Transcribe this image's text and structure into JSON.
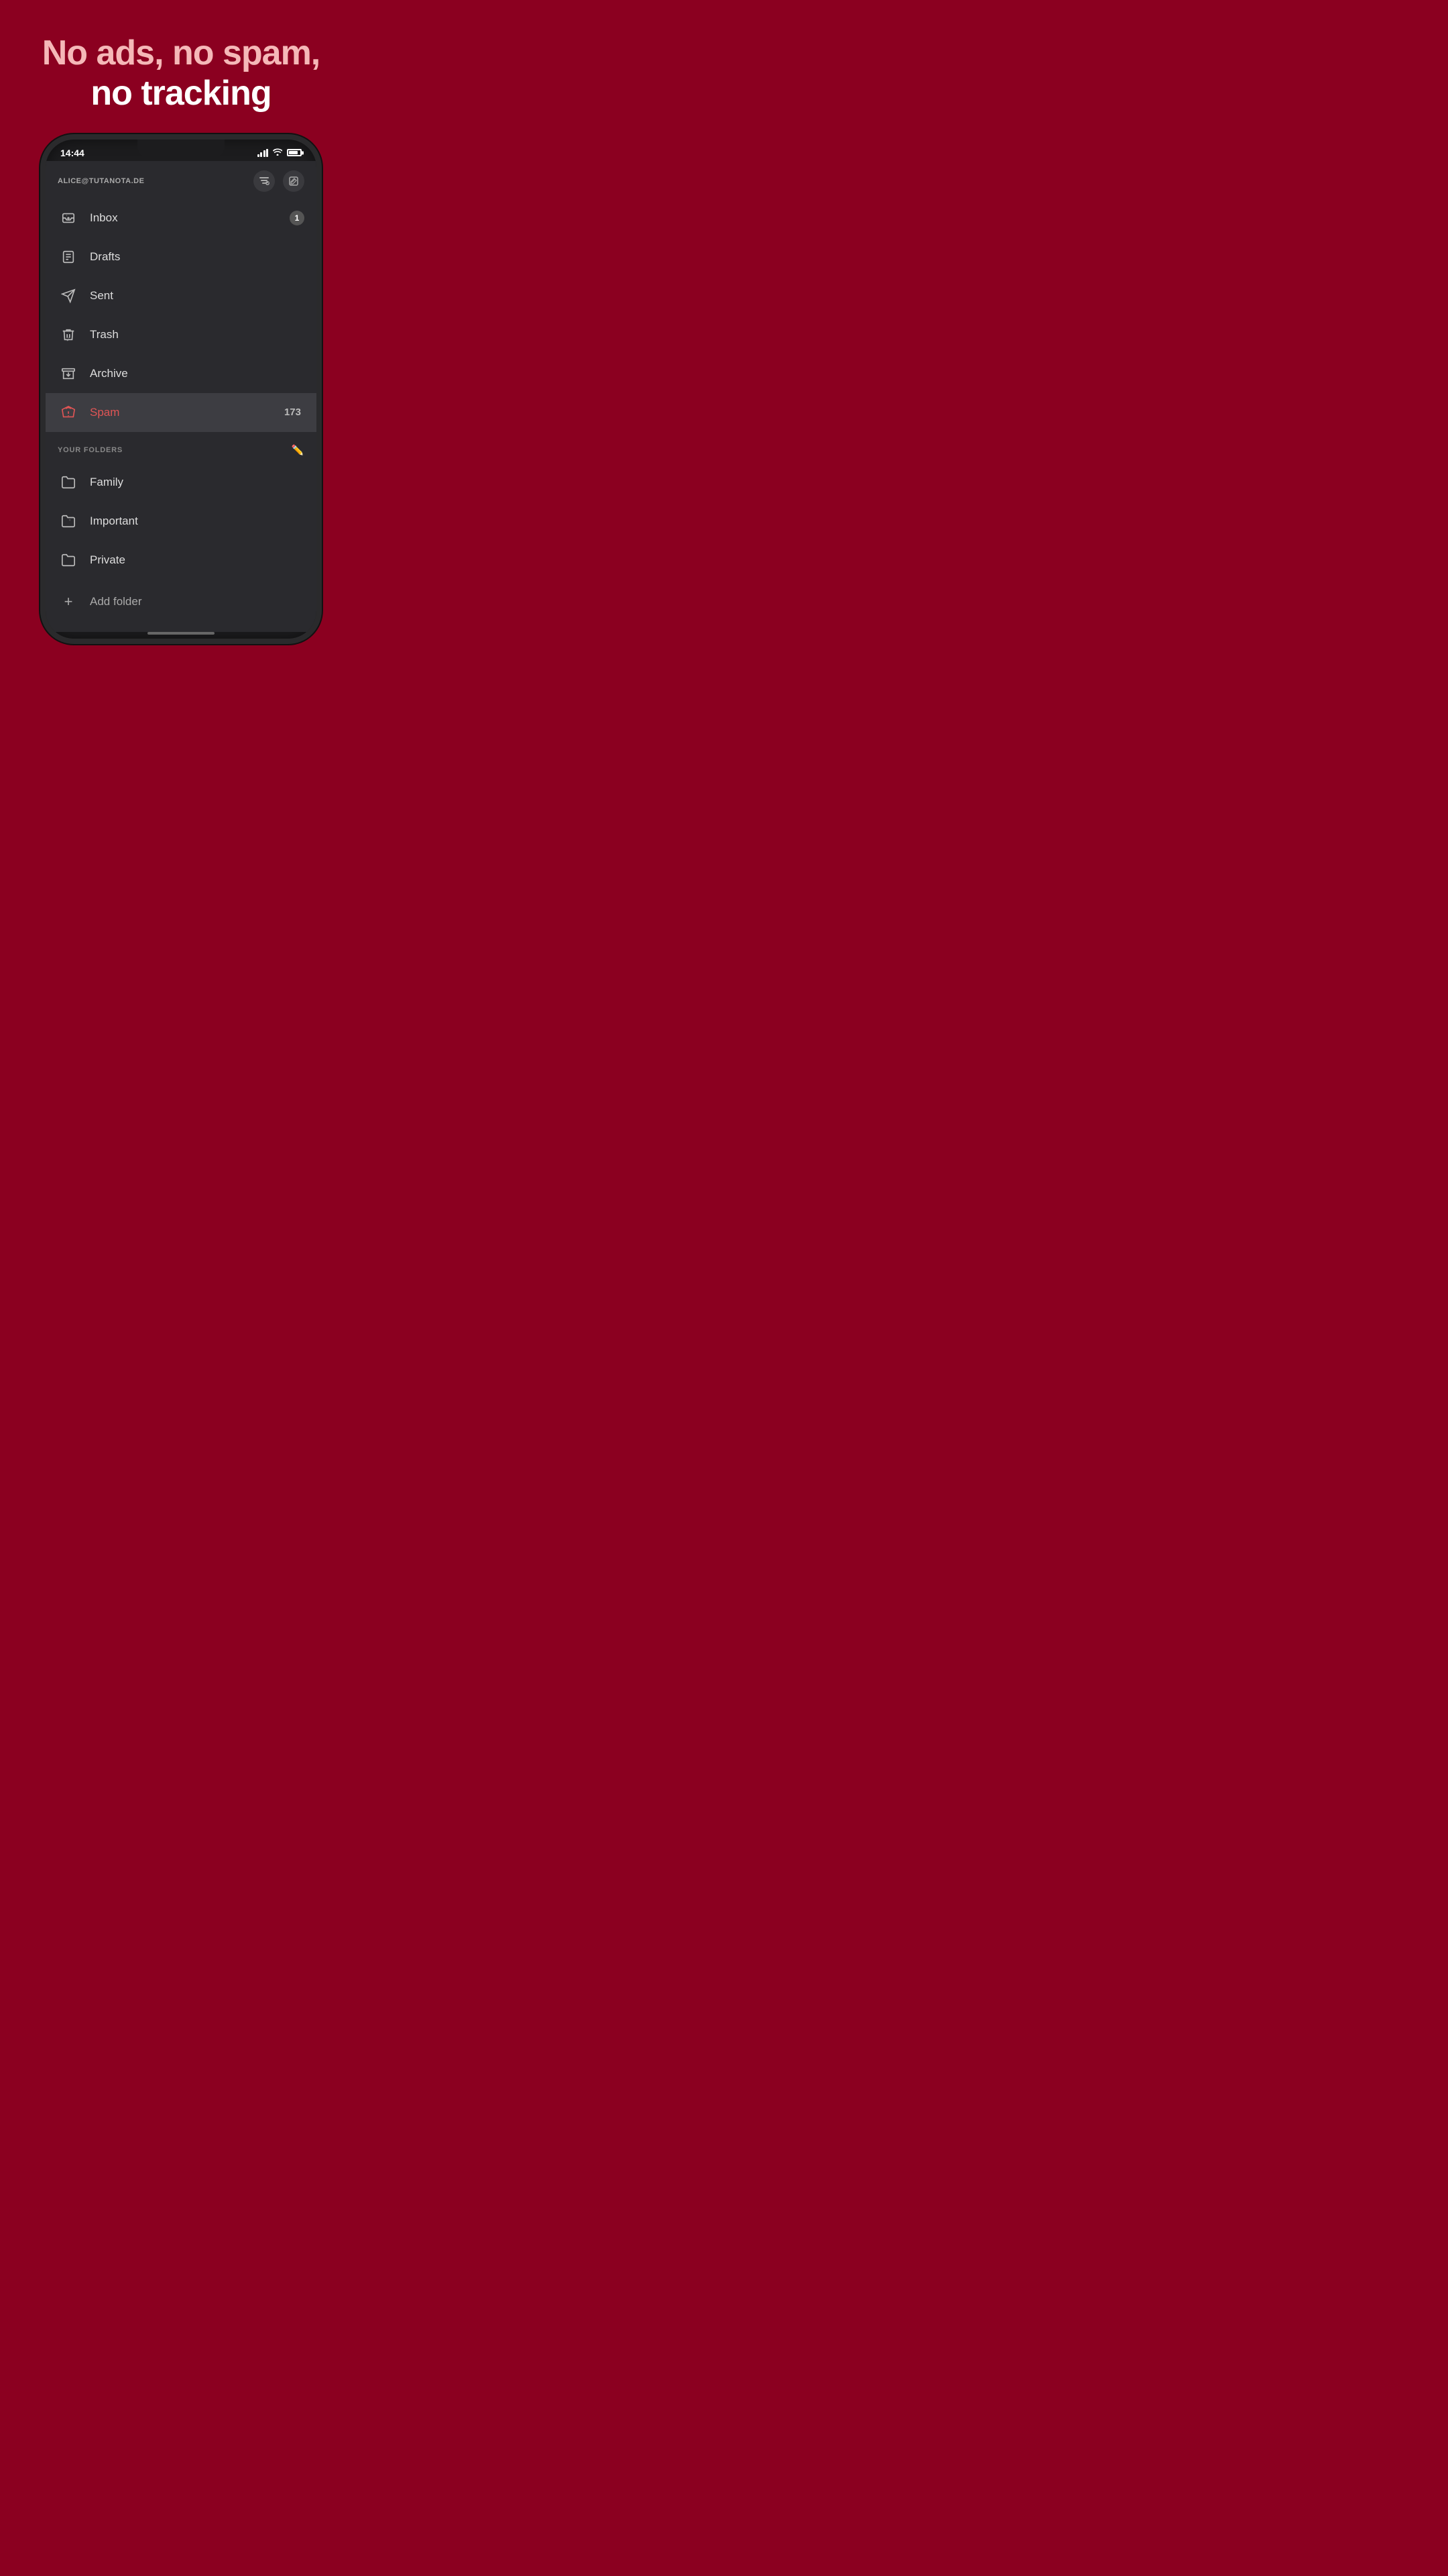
{
  "headline": {
    "line1": "No ads, no spam,",
    "line2": "no tracking"
  },
  "status_bar": {
    "time": "14:44"
  },
  "account": {
    "email": "ALICE@TUTANOTA.DE"
  },
  "nav_items": [
    {
      "id": "inbox",
      "label": "Inbox",
      "badge": "1",
      "icon": "inbox"
    },
    {
      "id": "drafts",
      "label": "Drafts",
      "badge": "",
      "icon": "drafts"
    },
    {
      "id": "sent",
      "label": "Sent",
      "badge": "",
      "icon": "sent"
    },
    {
      "id": "trash",
      "label": "Trash",
      "badge": "",
      "icon": "trash"
    },
    {
      "id": "archive",
      "label": "Archive",
      "badge": "",
      "icon": "archive"
    },
    {
      "id": "spam",
      "label": "Spam",
      "badge": "173",
      "icon": "spam",
      "active": true
    }
  ],
  "folders_section": {
    "title": "YOUR FOLDERS"
  },
  "folders": [
    {
      "id": "family",
      "label": "Family"
    },
    {
      "id": "important",
      "label": "Important"
    },
    {
      "id": "private",
      "label": "Private"
    }
  ],
  "add_folder_label": "Add folder"
}
